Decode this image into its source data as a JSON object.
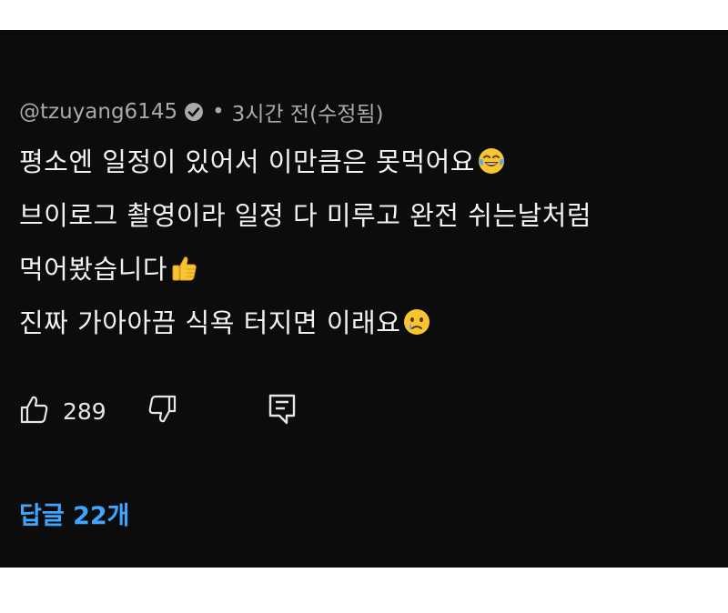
{
  "comment": {
    "author_handle": "@tzuyang6145",
    "separator": "•",
    "timestamp": "3시간 전(수정됨)",
    "lines": [
      "평소엔 일정이 있어서 이만큼은 못먹어요",
      "브이로그 촬영이라 일정 다 미루고 완전 쉬는날처럼",
      "먹어봤습니다",
      "진짜 가아아끔 식욕 터지면 이래요"
    ],
    "line_emojis": [
      "face-with-tears-of-joy",
      "none",
      "thumbs-up",
      "crying-face"
    ]
  },
  "actions": {
    "like_count": "289"
  },
  "replies": {
    "label": "답글 22개"
  },
  "colors": {
    "panel_background": "#0c0c0c",
    "page_background": "#ffffff",
    "text_primary": "#f2f2f2",
    "text_secondary": "#aaaaaa",
    "link_blue": "#3ea6ff"
  }
}
